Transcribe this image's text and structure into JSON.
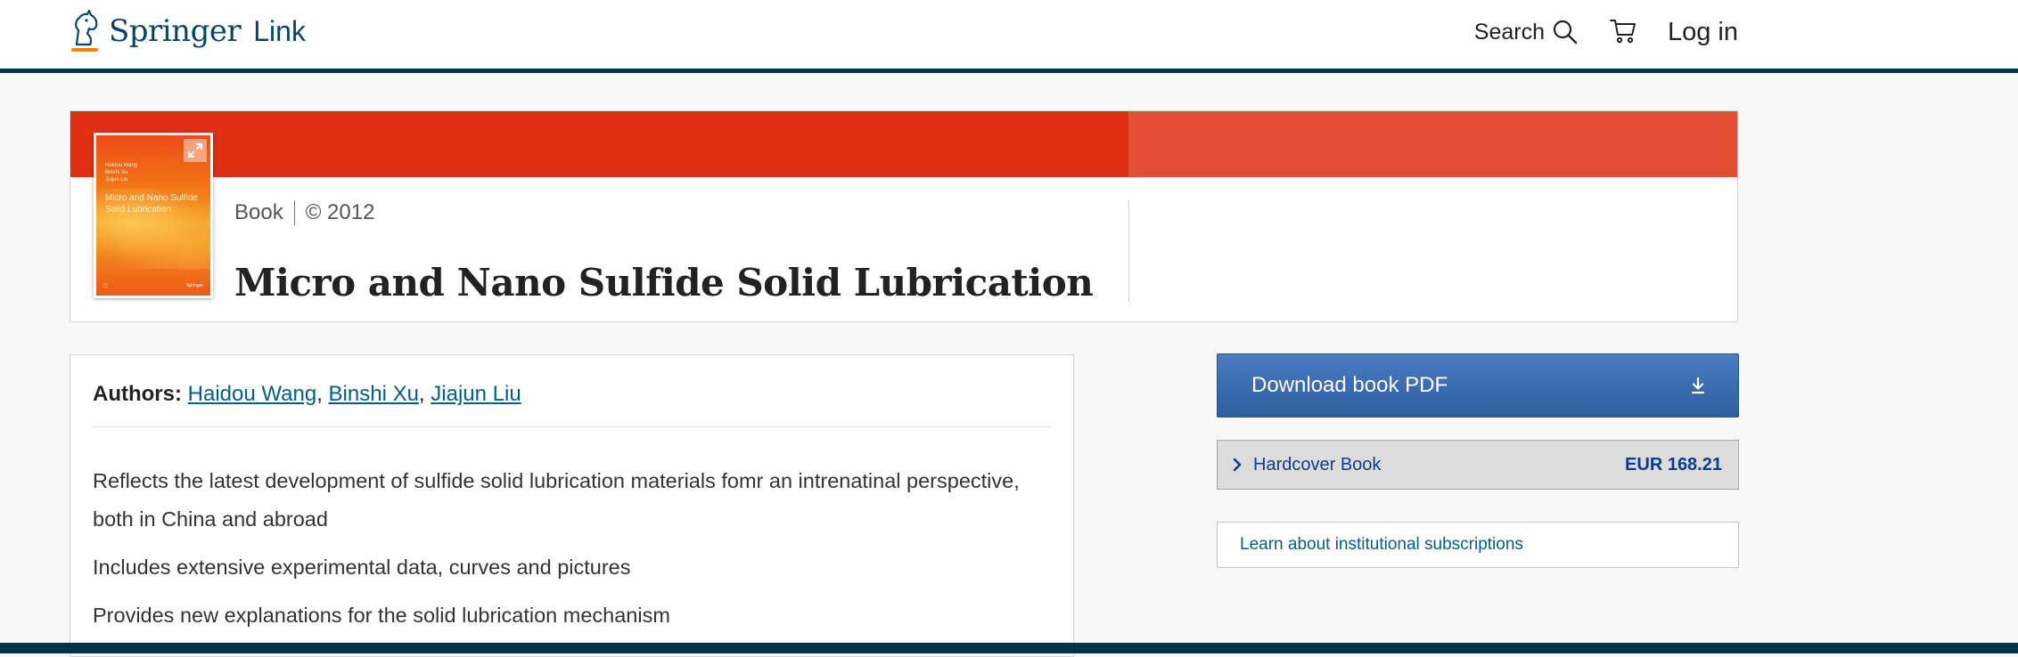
{
  "header": {
    "brand_name": "Springer",
    "brand_suffix": "Link",
    "search_label": "Search",
    "search_icon": "search-icon",
    "cart_icon": "cart-icon",
    "login_label": "Log in"
  },
  "colors": {
    "header_rule": "#01324b",
    "hero_band": "#e03014",
    "hero_band_light": "#e44e35",
    "brand_blue": "#07456d",
    "link_blue": "#025e8d",
    "download_button": "#3b6db0"
  },
  "book": {
    "type": "Book",
    "copyright": "© 2012",
    "title": "Micro and Nano Sulfide Solid Lubrication",
    "cover": {
      "authors": [
        "Haidou Wang",
        "Binshi Xu",
        "Jiajun Liu"
      ],
      "title": "Micro and Nano Sulfide Solid Lubrication",
      "publisher": "Springer",
      "expand_icon": "expand-icon"
    }
  },
  "details": {
    "authors_label": "Authors:",
    "authors": [
      "Haidou Wang",
      "Binshi Xu",
      "Jiajun Liu"
    ],
    "highlights": [
      "Reflects the latest development of sulfide solid lubrication materials fomr an intrenatinal perspective, both in China and abroad",
      "Includes extensive experimental data, curves and pictures",
      "Provides new explanations for the solid lubrication mechanism"
    ]
  },
  "sidebar": {
    "download_label": "Download book PDF",
    "download_icon": "download-icon",
    "hardcover_label": "Hardcover Book",
    "hardcover_price": "EUR 168.21",
    "hardcover_icon": "chevron-right-icon",
    "subscriptions_label": "Learn about institutional subscriptions"
  }
}
